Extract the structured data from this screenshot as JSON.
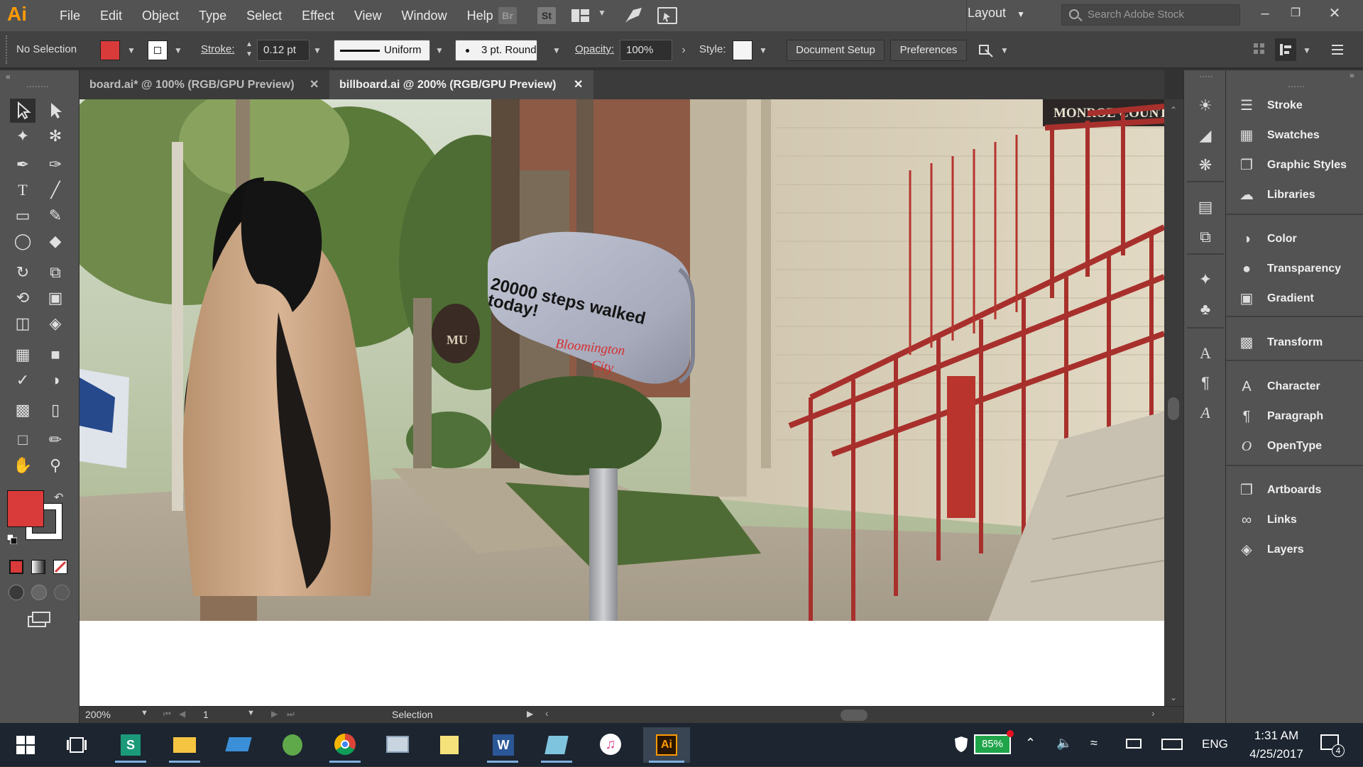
{
  "app": {
    "logo": "Ai",
    "menus": [
      "File",
      "Edit",
      "Object",
      "Type",
      "Select",
      "Effect",
      "View",
      "Window",
      "Help"
    ],
    "bridge_label": "Br",
    "stock_label": "St",
    "workspace": "Layout",
    "search_placeholder": "Search Adobe Stock",
    "colors": {
      "fill_red": "#d93a3a",
      "accent_orange": "#ff9a00"
    }
  },
  "control_bar": {
    "selection_status": "No Selection",
    "stroke_label": "Stroke:",
    "stroke_weight": "0.12 pt",
    "profile": "Uniform",
    "brush": "3 pt. Round",
    "opacity_label": "Opacity:",
    "opacity_value": "100%",
    "style_label": "Style:",
    "document_setup": "Document Setup",
    "preferences": "Preferences"
  },
  "tabs": [
    {
      "label": "board.ai* @ 100% (RGB/GPU Preview)",
      "active": false
    },
    {
      "label": "billboard.ai @ 200% (RGB/GPU Preview)",
      "active": true
    }
  ],
  "artwork": {
    "sign_line1": "20000 steps walked",
    "sign_line2": "today!",
    "signature_line1": "Bloomington",
    "signature_line2": "City",
    "building_sign": "MONROE COUNTY",
    "small_sign": "MU"
  },
  "status_bar": {
    "zoom": "200%",
    "artboard": "1",
    "tool": "Selection"
  },
  "panels": [
    {
      "label": "Stroke",
      "icon": "stroke-icon"
    },
    {
      "label": "Swatches",
      "icon": "swatches-icon"
    },
    {
      "label": "Graphic Styles",
      "icon": "graphic-styles-icon"
    },
    {
      "label": "Libraries",
      "icon": "libraries-icon"
    },
    {
      "label": "Color",
      "icon": "color-icon"
    },
    {
      "label": "Transparency",
      "icon": "transparency-icon"
    },
    {
      "label": "Gradient",
      "icon": "gradient-icon"
    },
    {
      "label": "Transform",
      "icon": "transform-icon"
    },
    {
      "label": "Character",
      "icon": "character-icon"
    },
    {
      "label": "Paragraph",
      "icon": "paragraph-icon"
    },
    {
      "label": "OpenType",
      "icon": "opentype-icon"
    },
    {
      "label": "Artboards",
      "icon": "artboards-icon"
    },
    {
      "label": "Links",
      "icon": "links-icon"
    },
    {
      "label": "Layers",
      "icon": "layers-icon"
    }
  ],
  "taskbar": {
    "battery": "85%",
    "language": "ENG",
    "time": "1:31 AM",
    "date": "4/25/2017",
    "notifications": "4"
  }
}
